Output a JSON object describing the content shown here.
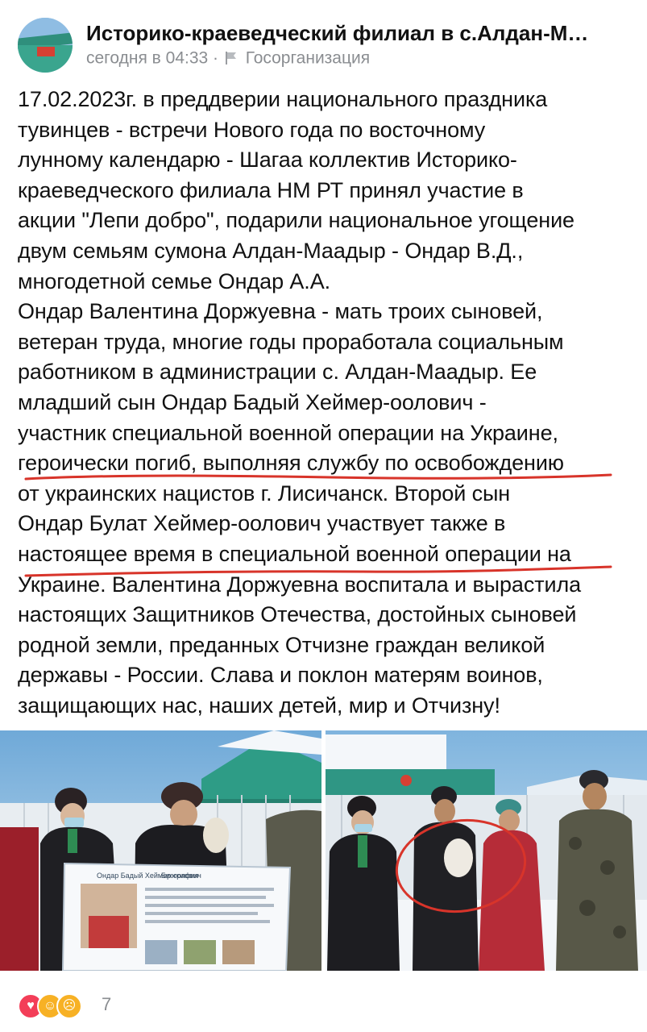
{
  "post": {
    "author": "Историко-краеведческий филиал в с.Алдан-М…",
    "timestamp": "сегодня в 04:33",
    "separator": "·",
    "category": "Госорганизация",
    "lines": [
      "17.02.2023г. в преддверии национального праздника",
      "тувинцев - встречи Нового года  по восточному",
      "лунному календарю - Шагаа коллектив Историко-",
      "краеведческого филиала НМ РТ принял участие в",
      "акции \"Лепи добро\", подарили национальное угощение",
      "двум семьям сумона Алдан-Маадыр - Ондар В.Д.,",
      "многодетной семье Ондар А.А.",
      "Ондар Валентина Доржуевна - мать троих сыновей,",
      "ветеран труда, многие годы проработала  социальным",
      "работником в администрации с. Алдан-Маадыр. Ее",
      "младший сын Ондар Бадый Хеймер-оолович -",
      "участник специальной военной операции на Украине,",
      "героически погиб, выполняя службу по освобождению",
      "от украинских нацистов г. Лисичанск. Второй сын",
      "Ондар Булат Хеймер-оолович участвует также в",
      "настоящее время в специальной военной операции на",
      "Украине. Валентина Доржуевна воспитала и вырастила",
      "настоящих Защитников Отечества, достойных сыновей",
      "родной земли, преданных Отчизне граждан великой",
      "державы - России. Слава и поклон матерям воинов,",
      "защищающих нас, наших детей, мир и Отчизну!"
    ]
  },
  "photo_left": {
    "banner_name": "Ондар Бадый Хеймер-оолович",
    "banner_heading": "Биография"
  },
  "reactions": {
    "icons": [
      "heart-reaction",
      "laugh-reaction",
      "cry-reaction"
    ],
    "count": "7"
  },
  "colors": {
    "underline": "#d8342a",
    "meta_gray": "#8a8d91",
    "heart": "#f33e58"
  }
}
